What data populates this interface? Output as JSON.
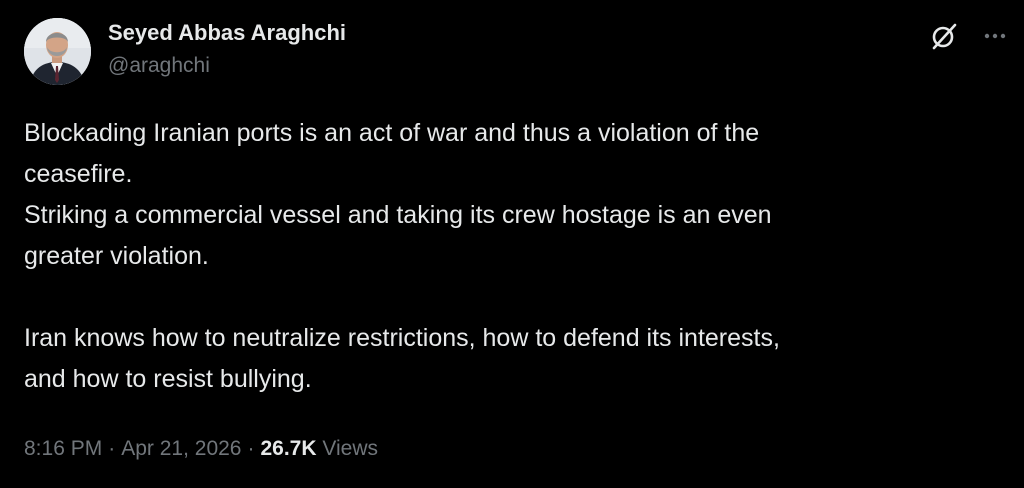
{
  "author": {
    "display_name": "Seyed Abbas Araghchi",
    "handle": "@araghchi",
    "avatar_icon": "profile-photo"
  },
  "header_actions": {
    "grok_icon": "slashed-circle-icon",
    "more_icon": "more-horizontal-icon"
  },
  "tweet": {
    "lines": [
      "Blockading Iranian ports is an act of war and thus a violation of the",
      "ceasefire.",
      "Striking a commercial vessel and taking its crew hostage is an even",
      "greater violation.",
      "",
      "Iran knows how to neutralize restrictions, how to defend its interests,",
      "and how to resist bullying."
    ]
  },
  "meta": {
    "time": "8:16 PM",
    "separator": "·",
    "date": "Apr 21, 2026",
    "views_count": "26.7K",
    "views_label": "Views"
  },
  "colors": {
    "background": "#000000",
    "primary_text": "#e7e9ea",
    "secondary_text": "#71767b"
  }
}
